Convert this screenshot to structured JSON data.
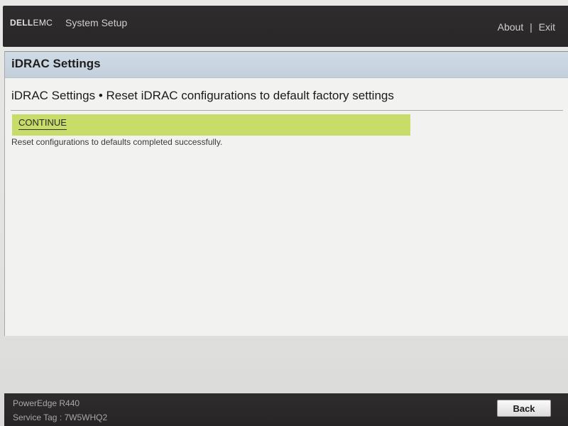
{
  "header": {
    "logo_brand": "DELL",
    "logo_sub": "EMC",
    "app_title": "System Setup",
    "about_label": "About",
    "separator": "|",
    "exit_label": "Exit"
  },
  "panel": {
    "header_title": "iDRAC Settings",
    "page_title": "iDRAC Settings • Reset iDRAC configurations to default factory settings",
    "continue_label": "CONTINUE",
    "status_message": "Reset configurations to defaults completed successfully."
  },
  "footer": {
    "model": "PowerEdge R440",
    "service_tag": "Service Tag : 7W5WHQ2",
    "back_label": "Back"
  },
  "colors": {
    "topbar": "#2f2c2e",
    "panel_header": "#c8d5e0",
    "highlight_row": "#c8dc6a",
    "panel_bg": "#f2f3f0"
  }
}
